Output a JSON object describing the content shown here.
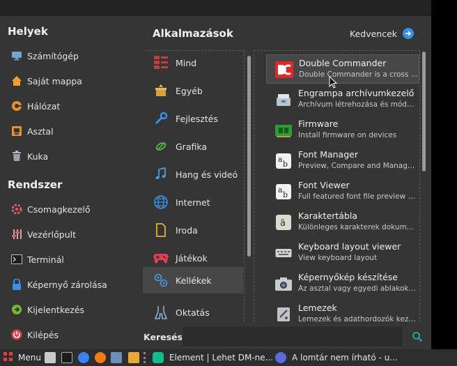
{
  "places": {
    "title": "Helyek",
    "items": [
      {
        "label": "Számítógép"
      },
      {
        "label": "Saját mappa"
      },
      {
        "label": "Hálózat"
      },
      {
        "label": "Asztal"
      },
      {
        "label": "Kuka"
      }
    ]
  },
  "system": {
    "title": "Rendszer",
    "items": [
      {
        "label": "Csomagkezelő"
      },
      {
        "label": "Vezérlőpult"
      },
      {
        "label": "Terminál"
      },
      {
        "label": "Képernyő zárolása"
      },
      {
        "label": "Kijelentkezés"
      },
      {
        "label": "Kilépés"
      }
    ]
  },
  "apps_header": {
    "title": "Alkalmazások",
    "favorites_label": "Kedvencek"
  },
  "categories": [
    {
      "label": "Mind"
    },
    {
      "label": "Egyéb"
    },
    {
      "label": "Fejlesztés"
    },
    {
      "label": "Grafika"
    },
    {
      "label": "Hang és videó"
    },
    {
      "label": "Internet"
    },
    {
      "label": "Iroda"
    },
    {
      "label": "Játékok"
    },
    {
      "label": "Kellékek"
    },
    {
      "label": "Oktatás"
    }
  ],
  "active_category": "Kellékek",
  "apps": [
    {
      "name": "Double Commander",
      "desc": "Double Commander is a cross platf..."
    },
    {
      "name": "Engrampa archívumkezelő",
      "desc": "Archívum létrehozása és módosítása"
    },
    {
      "name": "Firmware",
      "desc": "Install firmware on devices"
    },
    {
      "name": "Font Manager",
      "desc": "Preview, Compare and Manage Fon..."
    },
    {
      "name": "Font Viewer",
      "desc": "Full featured font file preview appli..."
    },
    {
      "name": "Karaktertábla",
      "desc": "Különleges karakterek dokumentu..."
    },
    {
      "name": "Keyboard layout viewer",
      "desc": "View keyboard layout"
    },
    {
      "name": "Képernyőkép készítése",
      "desc": "Az asztal vagy egyedi ablakok képe..."
    },
    {
      "name": "Lemezek",
      "desc": "Lemezek és adathordozók kezelése"
    }
  ],
  "search": {
    "label": "Keresés:",
    "value": "",
    "placeholder": ""
  },
  "taskbar": {
    "menu_label": "Menu",
    "windows": [
      {
        "title": "Element | Lehet DM-ne..."
      },
      {
        "title": "A lomtár nem írható - u..."
      }
    ]
  },
  "colors": {
    "menu_bg": "#353535",
    "accent": "#3a8ee6",
    "taskbar_bg": "#2d2d2d"
  }
}
